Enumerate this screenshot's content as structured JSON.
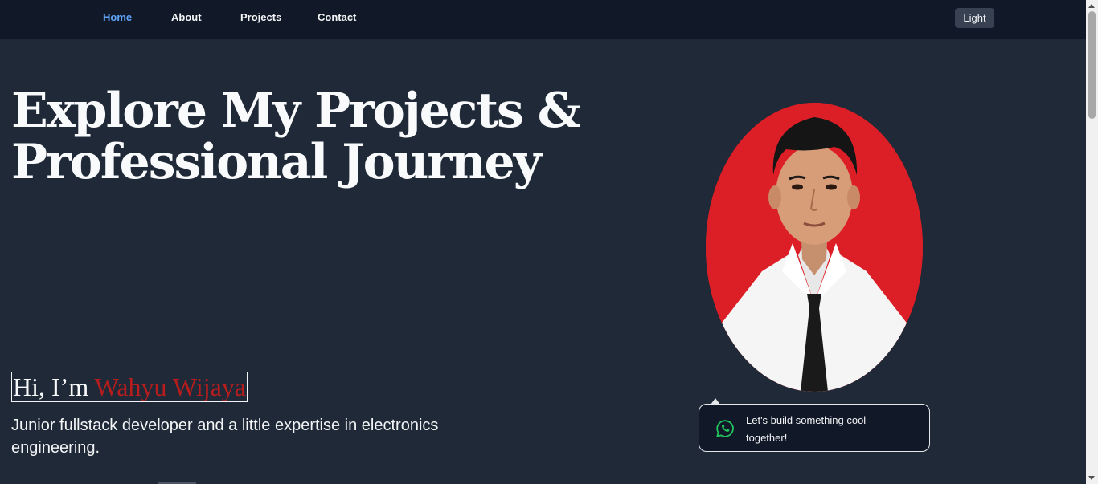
{
  "nav": {
    "items": [
      {
        "label": "Home",
        "active": true
      },
      {
        "label": "About",
        "active": false
      },
      {
        "label": "Projects",
        "active": false
      },
      {
        "label": "Contact",
        "active": false
      }
    ],
    "theme_toggle_label": "Light"
  },
  "hero": {
    "title_line1": "Explore My Projects &",
    "title_line2": "Professional Journey",
    "greeting_prefix": "Hi, I’m ",
    "greeting_name": "Wahyu Wijaya",
    "tagline": "Junior fullstack developer and a little expertise in electronics engineering."
  },
  "contact_bubble": {
    "text": "Let's build something cool together!",
    "icon": "whatsapp-icon"
  },
  "colors": {
    "page_bg": "#1f2937",
    "navbar_bg": "#111827",
    "accent_link": "#60a5fa",
    "name_red": "#b91c1c",
    "photo_bg": "#dc1f26",
    "whatsapp_green": "#22c55e"
  }
}
